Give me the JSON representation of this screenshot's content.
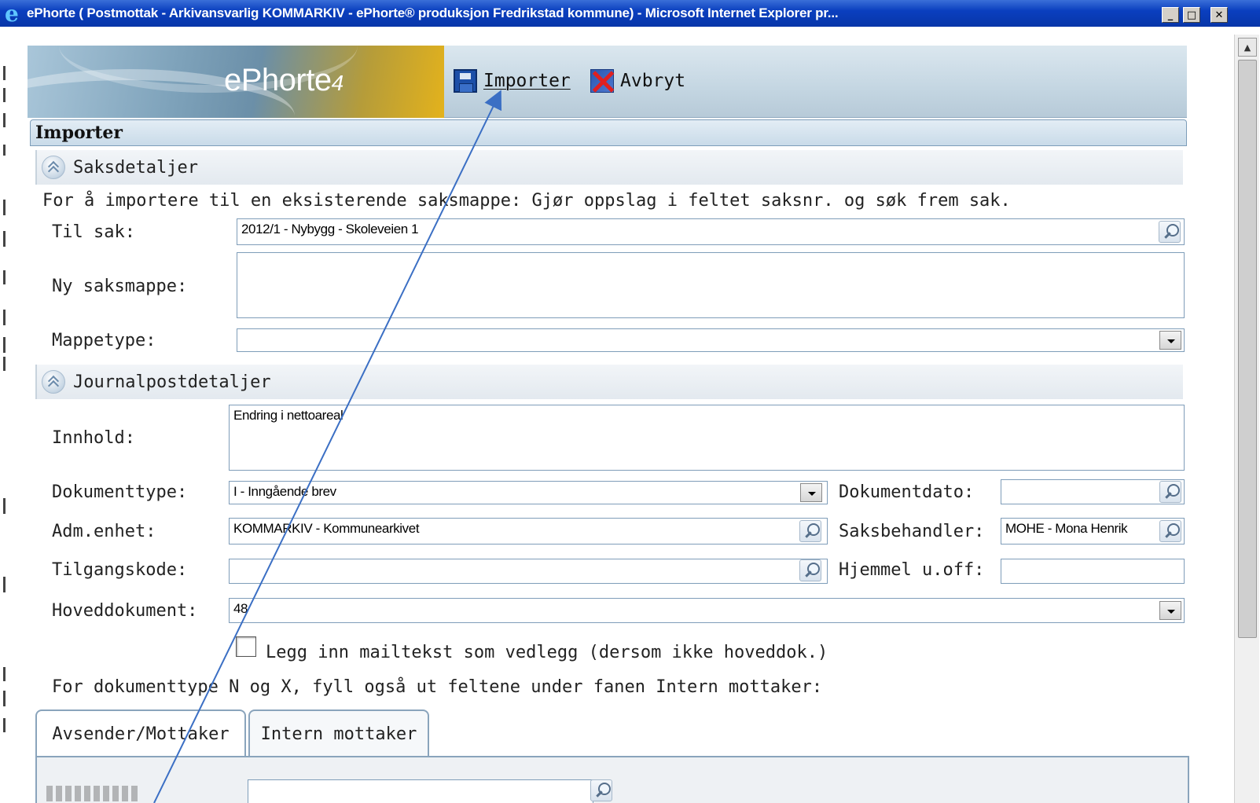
{
  "window": {
    "title": "ePhorte ( Postmottak - Arkivansvarlig KOMMARKIV - ePhorte® produksjon Fredrikstad kommune) - Microsoft Internet Explorer pr...",
    "minimize": "_",
    "maximize": "□",
    "close": "✕"
  },
  "header": {
    "logo": "ePhorte",
    "logo_version": "4",
    "importer_label": "Importer",
    "avbryt_label": "Avbryt"
  },
  "panel": {
    "title": "Importer"
  },
  "saksdetaljer": {
    "heading": "Saksdetaljer",
    "hint": "For å importere til en eksisterende saksmappe: Gjør oppslag i feltet saksnr. og søk frem sak.",
    "til_sak_label": "Til sak:",
    "til_sak_value": "2012/1 - Nybygg - Skoleveien 1",
    "ny_saksmappe_label": "Ny saksmappe:",
    "ny_saksmappe_value": "",
    "mappetype_label": "Mappetype:",
    "mappetype_value": ""
  },
  "journalpost": {
    "heading": "Journalpostdetaljer",
    "innhold_label": "Innhold:",
    "innhold_value": "Endring i nettoareal",
    "dokumenttype_label": "Dokumenttype:",
    "dokumenttype_value": "I - Inngående brev",
    "dokumentdato_label": "Dokumentdato:",
    "dokumentdato_value": "",
    "adm_enhet_label": "Adm.enhet:",
    "adm_enhet_value": "KOMMARKIV - Kommunearkivet",
    "saksbehandler_label": "Saksbehandler:",
    "saksbehandler_value": "MOHE - Mona Henrik",
    "tilgangskode_label": "Tilgangskode:",
    "tilgangskode_value": "",
    "hjemmel_label": "Hjemmel u.off:",
    "hjemmel_value": "",
    "hoveddokument_label": "Hoveddokument:",
    "hoveddokument_value": "48",
    "checkbox_label": "Legg inn mailtekst som vedlegg (dersom ikke hoveddok.)",
    "checkbox_checked": false,
    "note": "For dokumenttype N og X, fyll også ut feltene under fanen Intern mottaker:"
  },
  "tabs": [
    {
      "label": "Avsender/Mottaker",
      "active": true
    },
    {
      "label": "Intern mottaker",
      "active": false
    }
  ],
  "colors": {
    "titlebar": "#0a3fbf",
    "field_border": "#7f9db9",
    "arrow": "#3b6fc4"
  }
}
